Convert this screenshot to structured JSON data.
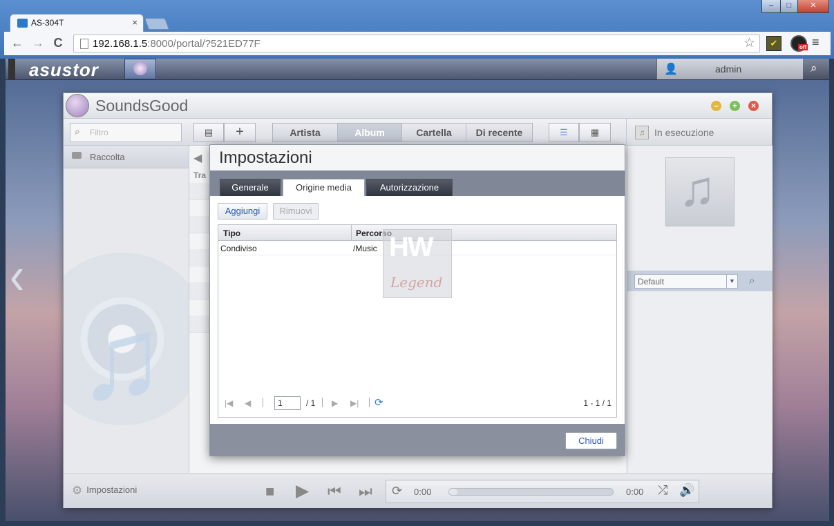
{
  "browser": {
    "tab_title": "AS-304T",
    "tab_close": "×",
    "url_host": "192.168.1.5",
    "url_rest": ":8000/portal/?521ED77F",
    "back": "←",
    "forward": "→",
    "reload": "C",
    "star": "☆",
    "menu": "≡",
    "win_min": "–",
    "win_max": "□",
    "win_close": "✕",
    "ext_badge": "off"
  },
  "adm": {
    "logo": "asustor",
    "user": "admin",
    "search": "⌕",
    "left_nav": "‹"
  },
  "app": {
    "name": "SoundsGood",
    "filter_placeholder": "Filtro",
    "tabs": [
      "Artista",
      "Album",
      "Cartella",
      "Di recente"
    ],
    "active_tab": "Album",
    "now_playing": "In esecuzione",
    "library": "Raccolta",
    "track_col": "Tra",
    "playlist_select": "Default",
    "settings": "Impostazioni",
    "time_current": "0:00",
    "time_total": "0:00",
    "progress_fraction": 0.0
  },
  "dialog": {
    "title": "Impostazioni",
    "tabs": [
      "Generale",
      "Origine media",
      "Autorizzazione"
    ],
    "active_tab": "Origine media",
    "add_button": "Aggiungi",
    "remove_button": "Rimuovi",
    "columns": [
      "Tipo",
      "Percorso"
    ],
    "rows": [
      {
        "tipo": "Condiviso",
        "percorso": "/Music"
      }
    ],
    "page_input": "1",
    "page_total": "/ 1",
    "record_count": "1 - 1 / 1",
    "close_button": "Chiudi"
  },
  "watermark": {
    "line1": "HW",
    "line2": "Legend"
  },
  "colors": {
    "browser_blue": "#4a80c3",
    "link_blue": "#2458b0",
    "dialog_header": "#808796"
  }
}
